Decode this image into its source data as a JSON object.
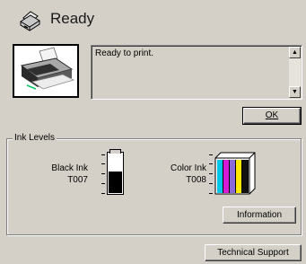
{
  "header": {
    "status": "Ready"
  },
  "message": {
    "text": "Ready to print."
  },
  "buttons": {
    "ok": "OK",
    "information": "Information",
    "technical_support": "Technical Support"
  },
  "ink_levels": {
    "group_label": "Ink Levels",
    "black": {
      "name": "Black Ink",
      "code": "T007",
      "level": 0.55
    },
    "color": {
      "name": "Color Ink",
      "code": "T008",
      "inks": [
        {
          "color": "#00c4e8",
          "level": 1.0
        },
        {
          "color": "#d51bd5",
          "level": 1.0
        },
        {
          "color": "#8a6ad8",
          "level": 1.0
        },
        {
          "color": "#ffe800",
          "level": 1.0
        },
        {
          "color": "#111111",
          "level": 1.0
        }
      ]
    }
  },
  "icons": {
    "header": "printer-icon",
    "picture": "printer-picture"
  }
}
